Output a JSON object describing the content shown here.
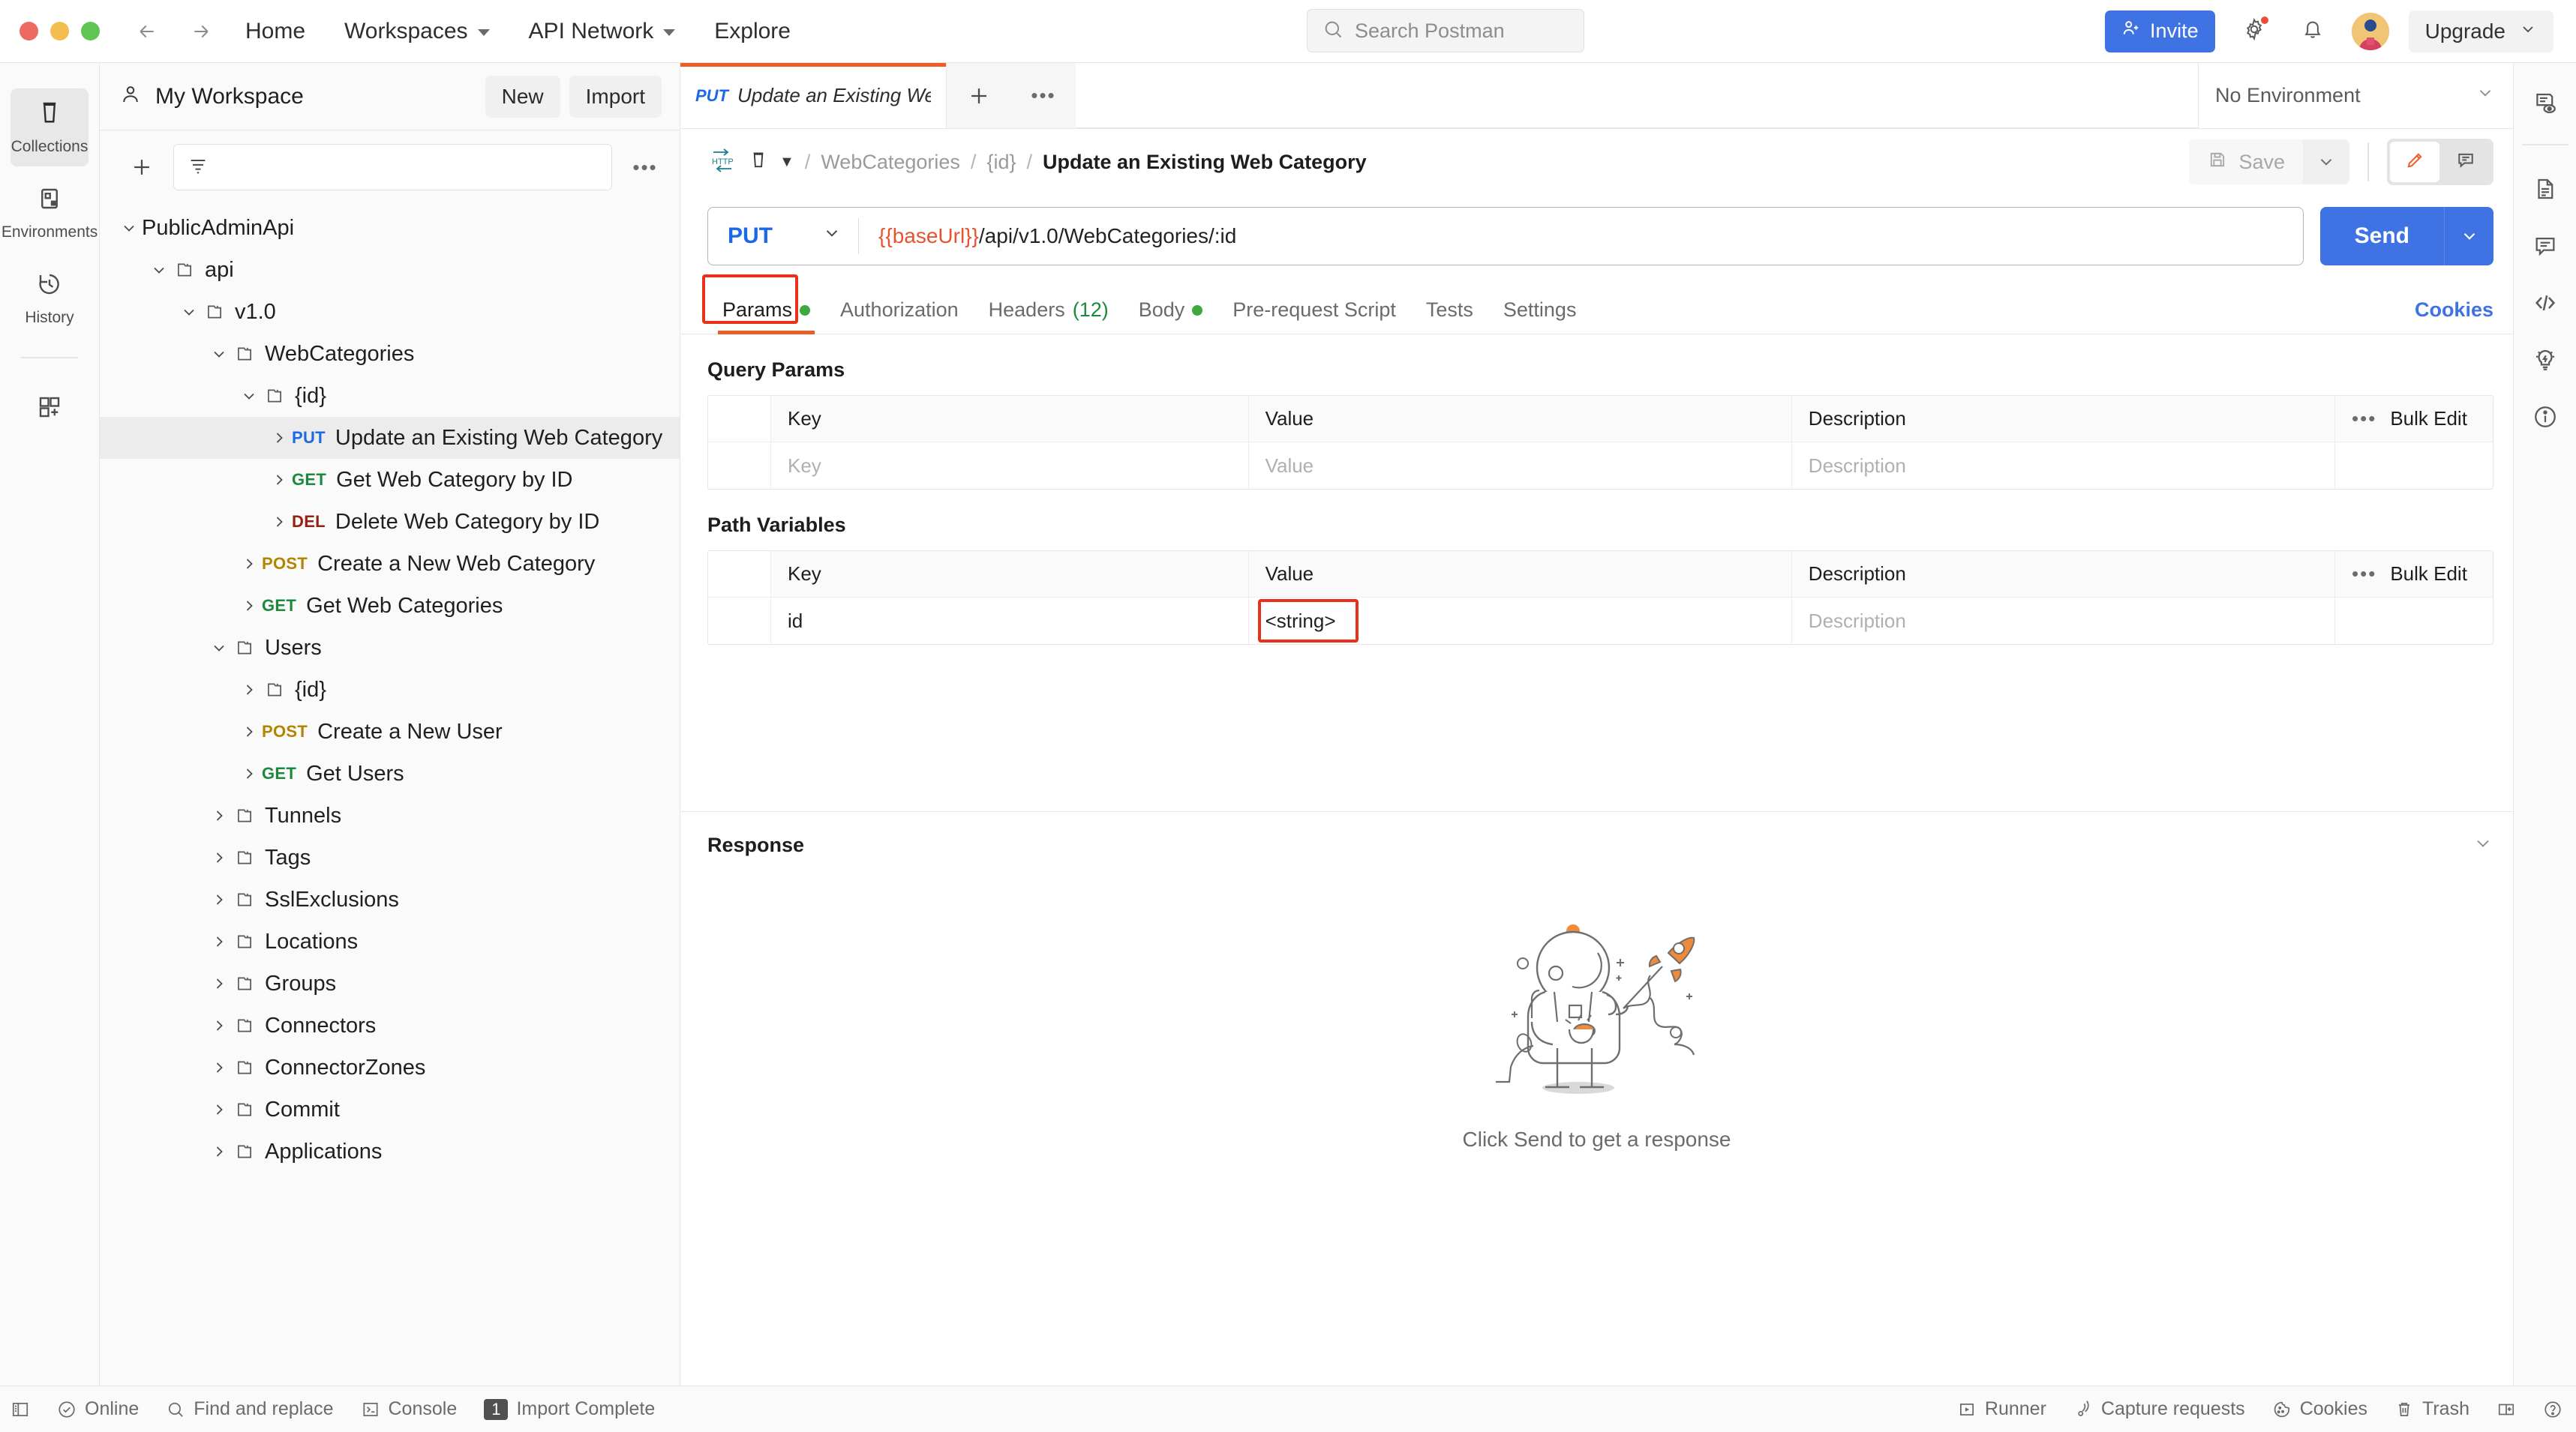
{
  "app": {
    "header": {
      "nav": [
        {
          "label": "Home",
          "caret": false
        },
        {
          "label": "Workspaces",
          "caret": true
        },
        {
          "label": "API Network",
          "caret": true
        },
        {
          "label": "Explore",
          "caret": false
        }
      ],
      "search_placeholder": "Search Postman",
      "invite_label": "Invite",
      "upgrade_label": "Upgrade",
      "accent_blue": "#3f73e3",
      "accent_orange": "#ef5b25"
    },
    "rail": [
      {
        "label": "Collections",
        "icon": "collections-icon",
        "active": true
      },
      {
        "label": "Environments",
        "icon": "environments-icon",
        "active": false
      },
      {
        "label": "History",
        "icon": "history-icon",
        "active": false
      },
      {
        "label": "",
        "icon": "apps-grid-icon",
        "active": false
      }
    ],
    "sidebar": {
      "workspace_name": "My Workspace",
      "new_label": "New",
      "import_label": "Import",
      "filter_placeholder": "",
      "tree": [
        {
          "label": "PublicAdminApi",
          "indent": 0,
          "chev": "down",
          "folder": false,
          "method": "",
          "selected": false
        },
        {
          "label": "api",
          "indent": 1,
          "chev": "down",
          "folder": true,
          "method": "",
          "selected": false
        },
        {
          "label": "v1.0",
          "indent": 2,
          "chev": "down",
          "folder": true,
          "method": "",
          "selected": false
        },
        {
          "label": "WebCategories",
          "indent": 3,
          "chev": "down",
          "folder": true,
          "method": "",
          "selected": false
        },
        {
          "label": "{id}",
          "indent": 4,
          "chev": "down",
          "folder": true,
          "method": "",
          "selected": false
        },
        {
          "label": "Update an Existing Web Category",
          "indent": 5,
          "chev": "right",
          "folder": false,
          "method": "PUT",
          "selected": true
        },
        {
          "label": "Get Web Category by ID",
          "indent": 5,
          "chev": "right",
          "folder": false,
          "method": "GET",
          "selected": false
        },
        {
          "label": "Delete Web Category by ID",
          "indent": 5,
          "chev": "right",
          "folder": false,
          "method": "DEL",
          "selected": false
        },
        {
          "label": "Create a New Web Category",
          "indent": 4,
          "chev": "right",
          "folder": false,
          "method": "POST",
          "selected": false
        },
        {
          "label": "Get Web Categories",
          "indent": 4,
          "chev": "right",
          "folder": false,
          "method": "GET",
          "selected": false
        },
        {
          "label": "Users",
          "indent": 3,
          "chev": "down",
          "folder": true,
          "method": "",
          "selected": false
        },
        {
          "label": "{id}",
          "indent": 4,
          "chev": "right",
          "folder": true,
          "method": "",
          "selected": false
        },
        {
          "label": "Create a New User",
          "indent": 4,
          "chev": "right",
          "folder": false,
          "method": "POST",
          "selected": false
        },
        {
          "label": "Get Users",
          "indent": 4,
          "chev": "right",
          "folder": false,
          "method": "GET",
          "selected": false
        },
        {
          "label": "Tunnels",
          "indent": 3,
          "chev": "right",
          "folder": true,
          "method": "",
          "selected": false
        },
        {
          "label": "Tags",
          "indent": 3,
          "chev": "right",
          "folder": true,
          "method": "",
          "selected": false
        },
        {
          "label": "SslExclusions",
          "indent": 3,
          "chev": "right",
          "folder": true,
          "method": "",
          "selected": false
        },
        {
          "label": "Locations",
          "indent": 3,
          "chev": "right",
          "folder": true,
          "method": "",
          "selected": false
        },
        {
          "label": "Groups",
          "indent": 3,
          "chev": "right",
          "folder": true,
          "method": "",
          "selected": false
        },
        {
          "label": "Connectors",
          "indent": 3,
          "chev": "right",
          "folder": true,
          "method": "",
          "selected": false
        },
        {
          "label": "ConnectorZones",
          "indent": 3,
          "chev": "right",
          "folder": true,
          "method": "",
          "selected": false
        },
        {
          "label": "Commit",
          "indent": 3,
          "chev": "right",
          "folder": true,
          "method": "",
          "selected": false
        },
        {
          "label": "Applications",
          "indent": 3,
          "chev": "right",
          "folder": true,
          "method": "",
          "selected": false
        }
      ]
    },
    "tabstrip": {
      "open_tab": {
        "method": "PUT",
        "title": "Update an Existing Web C"
      },
      "environment": "No Environment"
    },
    "breadcrumb": {
      "protocol": "HTTP",
      "items": [
        "WebCategories",
        "{id}"
      ],
      "current": "Update an Existing Web Category",
      "save_label": "Save"
    },
    "request": {
      "method": "PUT",
      "url_variable": "{{baseUrl}}",
      "url_path": "/api/v1.0/WebCategories/:id",
      "send_label": "Send",
      "cookies_label": "Cookies",
      "tabs": [
        {
          "label": "Params",
          "active": true,
          "dot": true,
          "count": ""
        },
        {
          "label": "Authorization",
          "active": false,
          "dot": false,
          "count": ""
        },
        {
          "label": "Headers",
          "active": false,
          "dot": false,
          "count": "(12)"
        },
        {
          "label": "Body",
          "active": false,
          "dot": true,
          "count": ""
        },
        {
          "label": "Pre-request Script",
          "active": false,
          "dot": false,
          "count": ""
        },
        {
          "label": "Tests",
          "active": false,
          "dot": false,
          "count": ""
        },
        {
          "label": "Settings",
          "active": false,
          "dot": false,
          "count": ""
        }
      ]
    },
    "query_params": {
      "title": "Query Params",
      "columns": [
        "Key",
        "Value",
        "Description"
      ],
      "bulk_edit_label": "Bulk Edit",
      "rows": [
        {
          "key": "",
          "value": "",
          "description": "",
          "key_ph": "Key",
          "value_ph": "Value",
          "desc_ph": "Description"
        }
      ]
    },
    "path_variables": {
      "title": "Path Variables",
      "columns": [
        "Key",
        "Value",
        "Description"
      ],
      "bulk_edit_label": "Bulk Edit",
      "rows": [
        {
          "key": "id",
          "value": "<string>",
          "description": "",
          "desc_ph": "Description",
          "highlighted": true
        }
      ]
    },
    "response": {
      "title": "Response",
      "empty_message": "Click Send to get a response"
    },
    "statusbar": {
      "left": [
        {
          "label": "",
          "icon": "sidebar-toggle-icon",
          "badge": ""
        },
        {
          "label": "Online",
          "icon": "online-check-icon",
          "badge": ""
        },
        {
          "label": "Find and replace",
          "icon": "search-icon",
          "badge": ""
        },
        {
          "label": "Console",
          "icon": "console-icon",
          "badge": ""
        },
        {
          "label": "Import Complete",
          "icon": "",
          "badge": "1"
        }
      ],
      "right": [
        {
          "label": "Runner",
          "icon": "runner-play-icon"
        },
        {
          "label": "Capture requests",
          "icon": "capture-signal-icon"
        },
        {
          "label": "Cookies",
          "icon": "cookie-icon"
        },
        {
          "label": "Trash",
          "icon": "trash-icon"
        },
        {
          "label": "",
          "icon": "layout-panel-icon"
        },
        {
          "label": "",
          "icon": "help-circle-icon"
        }
      ]
    },
    "right_rail": [
      {
        "icon": "preview-doc-eye-icon"
      },
      {
        "icon": "documentation-icon"
      },
      {
        "icon": "comment-icon"
      },
      {
        "icon": "code-icon"
      },
      {
        "icon": "info-bolt-lightbulb-icon"
      },
      {
        "icon": "info-circle-icon"
      }
    ]
  }
}
